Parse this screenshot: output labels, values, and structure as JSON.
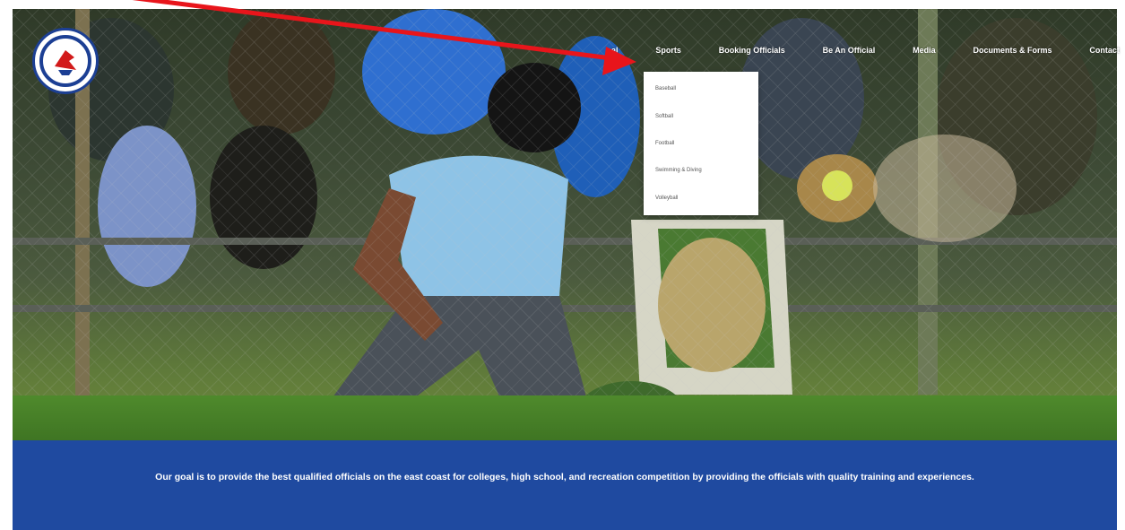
{
  "nav": {
    "items": [
      {
        "label": "al"
      },
      {
        "label": "Sports"
      },
      {
        "label": "Booking Officials"
      },
      {
        "label": "Be An Official"
      },
      {
        "label": "Media"
      },
      {
        "label": "Documents & Forms"
      },
      {
        "label": "Contact"
      }
    ]
  },
  "sports_menu": {
    "items": [
      {
        "label": "Baseball"
      },
      {
        "label": "Softball"
      },
      {
        "label": "Football"
      },
      {
        "label": "Swimming & Diving"
      },
      {
        "label": "Volleyball"
      }
    ]
  },
  "banner": {
    "text": "Our goal is to provide the best qualified officials on the east coast for colleges, high school, and recreation competition by providing the officials with quality training and experiences."
  },
  "colors": {
    "banner": "#1f4aa0",
    "arrow": "#e8151b",
    "logo_ring": "#1c3f94"
  },
  "icons": {
    "logo": "cardinal-bird-logo",
    "annotation": "red-pointer-arrow"
  }
}
